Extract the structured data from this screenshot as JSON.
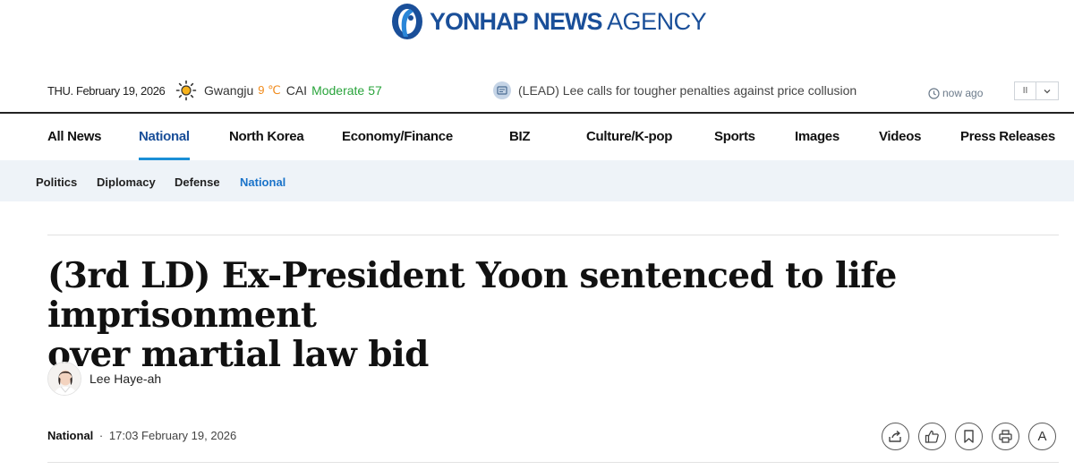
{
  "brand": {
    "logo_bold": "YONHAP NEWS",
    "logo_light": "AGENCY",
    "color": "#1a4f99"
  },
  "infobar": {
    "date": "THU. February 19, 2026",
    "weather": {
      "icon": "sun-icon",
      "city": "Gwangju",
      "temp": "9 ℃",
      "cai_label": "CAI",
      "cai_status": "Moderate",
      "cai_value": "57"
    },
    "ticker": {
      "icon": "news-icon",
      "headline": "(LEAD) Lee calls for tougher penalties against price collusion",
      "time": "now ago"
    },
    "pager": {
      "pause_label": "II",
      "next_label": "⌄"
    }
  },
  "mainnav": {
    "items": [
      {
        "label": "All News"
      },
      {
        "label": "National",
        "active": true
      },
      {
        "label": "North Korea"
      },
      {
        "label": "Economy/Finance"
      },
      {
        "label": "BIZ"
      },
      {
        "label": "Culture/K-pop"
      },
      {
        "label": "Sports"
      },
      {
        "label": "Images"
      },
      {
        "label": "Videos"
      },
      {
        "label": "Press Releases"
      }
    ]
  },
  "subnav": {
    "items": [
      {
        "label": "Politics"
      },
      {
        "label": "Diplomacy"
      },
      {
        "label": "Defense"
      },
      {
        "label": "National",
        "active": true
      }
    ]
  },
  "article": {
    "headline_line1": "(3rd LD) Ex-President Yoon sentenced to life imprisonment",
    "headline_line2": "over martial law bid",
    "author": "Lee Haye-ah",
    "section": "National",
    "separator": "·",
    "timestamp": "17:03 February 19, 2026"
  },
  "actions": [
    {
      "icon": "share-icon"
    },
    {
      "icon": "like-icon"
    },
    {
      "icon": "bookmark-icon"
    },
    {
      "icon": "print-icon"
    },
    {
      "icon": "font-size-icon",
      "label": "A"
    }
  ],
  "colors": {
    "accent": "#1a4f99",
    "nav_underline": "#1a8fd6",
    "subnav_bg": "#eef3f8",
    "temperature": "#f08a1a",
    "air_quality": "#2aa43c"
  }
}
